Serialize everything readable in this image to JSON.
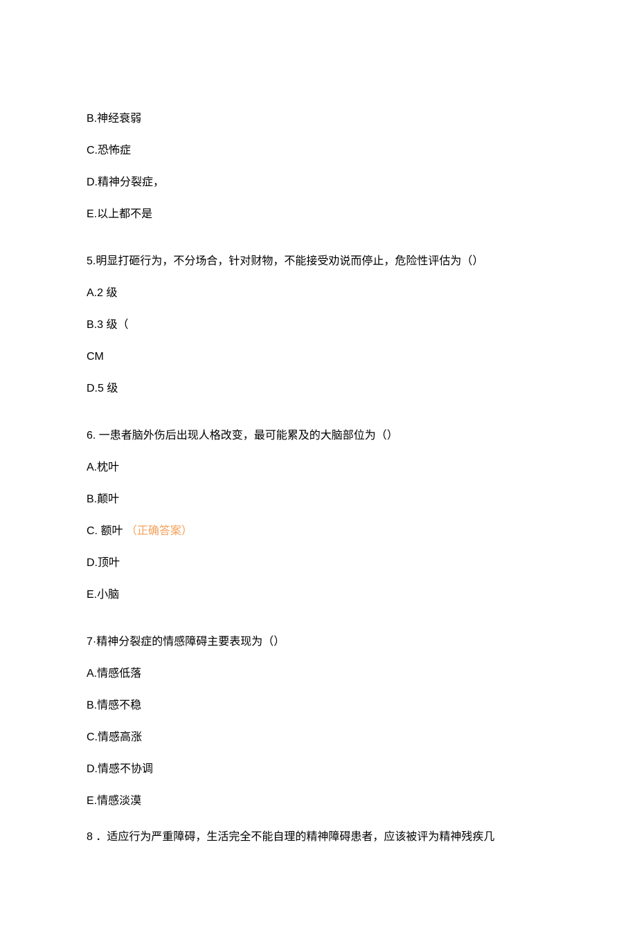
{
  "q4_options": {
    "b": "B.神经衰弱",
    "c": "C.恐怖症",
    "d": "D.精神分裂症，",
    "e": "E.以上都不是"
  },
  "q5": {
    "stem": "5.明显打砸行为，不分场合，针对财物，不能接受劝说而停止，危险性评估为（）",
    "a": "A.2 级",
    "b": "B.3 级（",
    "c": "CM",
    "d": "D.5 级"
  },
  "q6": {
    "stem": "6. 一患者脑外伤后出现人格改变，最可能累及的大脑部位为（）",
    "a": "A.枕叶",
    "b": "B.颠叶",
    "c": "C. 额叶",
    "c_mark": "（正确答案）",
    "d": "D.顶叶",
    "e": "E.小脑"
  },
  "q7": {
    "stem": "7·精神分裂症的情感障碍主要表现为（）",
    "a": "A.情感低落",
    "b": "B.情感不稳",
    "c": "C.情感高涨",
    "d": "D.情感不协调",
    "e": "E.情感淡漠"
  },
  "q8": {
    "stem": "8 ．适应行为严重障碍，生活完全不能自理的精神障碍患者，应该被评为精神残疾几"
  }
}
